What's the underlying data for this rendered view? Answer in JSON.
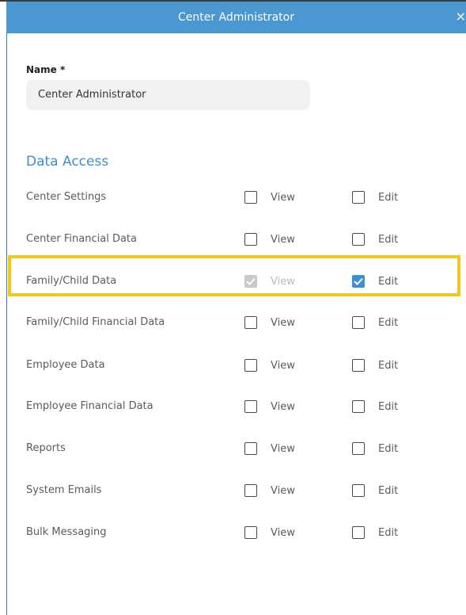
{
  "header": {
    "title": "Center Administrator",
    "close": "×"
  },
  "name_field": {
    "label": "Name *",
    "value": "Center Administrator"
  },
  "section": {
    "title": "Data Access"
  },
  "labels": {
    "view": "View",
    "edit": "Edit"
  },
  "rows": [
    {
      "label": "Center Settings",
      "view": "unchecked",
      "edit": "unchecked"
    },
    {
      "label": "Center Financial Data",
      "view": "unchecked",
      "edit": "unchecked"
    },
    {
      "label": "Family/Child Data",
      "view": "checked-disabled",
      "edit": "checked",
      "highlighted": true
    },
    {
      "label": "Family/Child Financial Data",
      "view": "unchecked",
      "edit": "unchecked"
    },
    {
      "label": "Employee Data",
      "view": "unchecked",
      "edit": "unchecked"
    },
    {
      "label": "Employee Financial Data",
      "view": "unchecked",
      "edit": "unchecked"
    },
    {
      "label": "Reports",
      "view": "unchecked",
      "edit": "unchecked"
    },
    {
      "label": "System Emails",
      "view": "unchecked",
      "edit": "unchecked"
    },
    {
      "label": "Bulk Messaging",
      "view": "unchecked",
      "edit": "unchecked"
    }
  ],
  "colors": {
    "header_bg": "#4b97d2",
    "accent": "#3d8ed4",
    "highlight": "#f5c518"
  }
}
